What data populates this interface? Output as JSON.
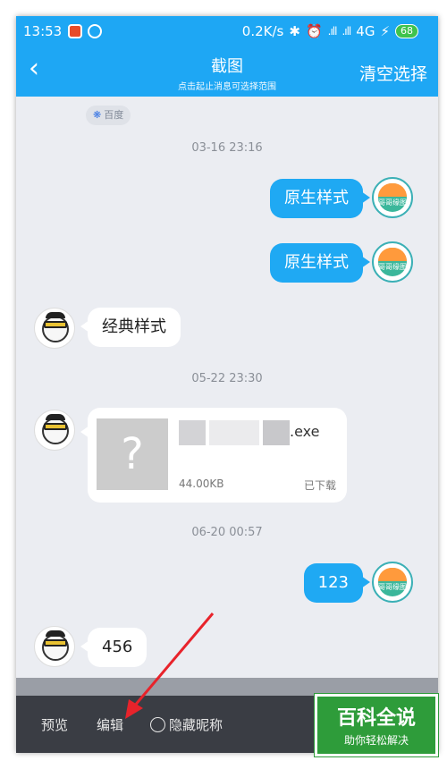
{
  "status_bar": {
    "time": "13:53",
    "network_speed": "0.2K/s",
    "signal1": ".ıll",
    "signal2": ".ıll",
    "network_type": "4G",
    "battery": "68"
  },
  "header": {
    "title": "截图",
    "subtitle": "点击起止消息可选择范围",
    "clear_label": "清空选择"
  },
  "baidu_tag": "百度",
  "messages": [
    {
      "timestamp": "03-16 23:16"
    },
    {
      "side": "me",
      "text": "原生样式"
    },
    {
      "side": "me",
      "text": "原生样式"
    },
    {
      "side": "other",
      "text": "经典样式"
    },
    {
      "timestamp": "05-22 23:30"
    },
    {
      "side": "other",
      "file": {
        "name": ".exe",
        "size": "44.00KB",
        "status": "已下载"
      }
    },
    {
      "timestamp": "06-20 00:57"
    },
    {
      "side": "me",
      "text": "123"
    },
    {
      "side": "other",
      "text": "456"
    }
  ],
  "avatar_me_label": "哥哥缘图",
  "bottom_bar": {
    "preview_label": "预览",
    "edit_label": "编辑",
    "hide_nickname_label": "隐藏昵称"
  },
  "watermark": {
    "title": "百科全说",
    "subtitle": "助你轻松解决"
  },
  "colors": {
    "header_blue": "#1ea7f4",
    "bubble_me": "#1fa9f3",
    "bottom_bar": "#3a3d44",
    "annotation_red": "#e8232b",
    "watermark_green": "#2e9c3a"
  }
}
